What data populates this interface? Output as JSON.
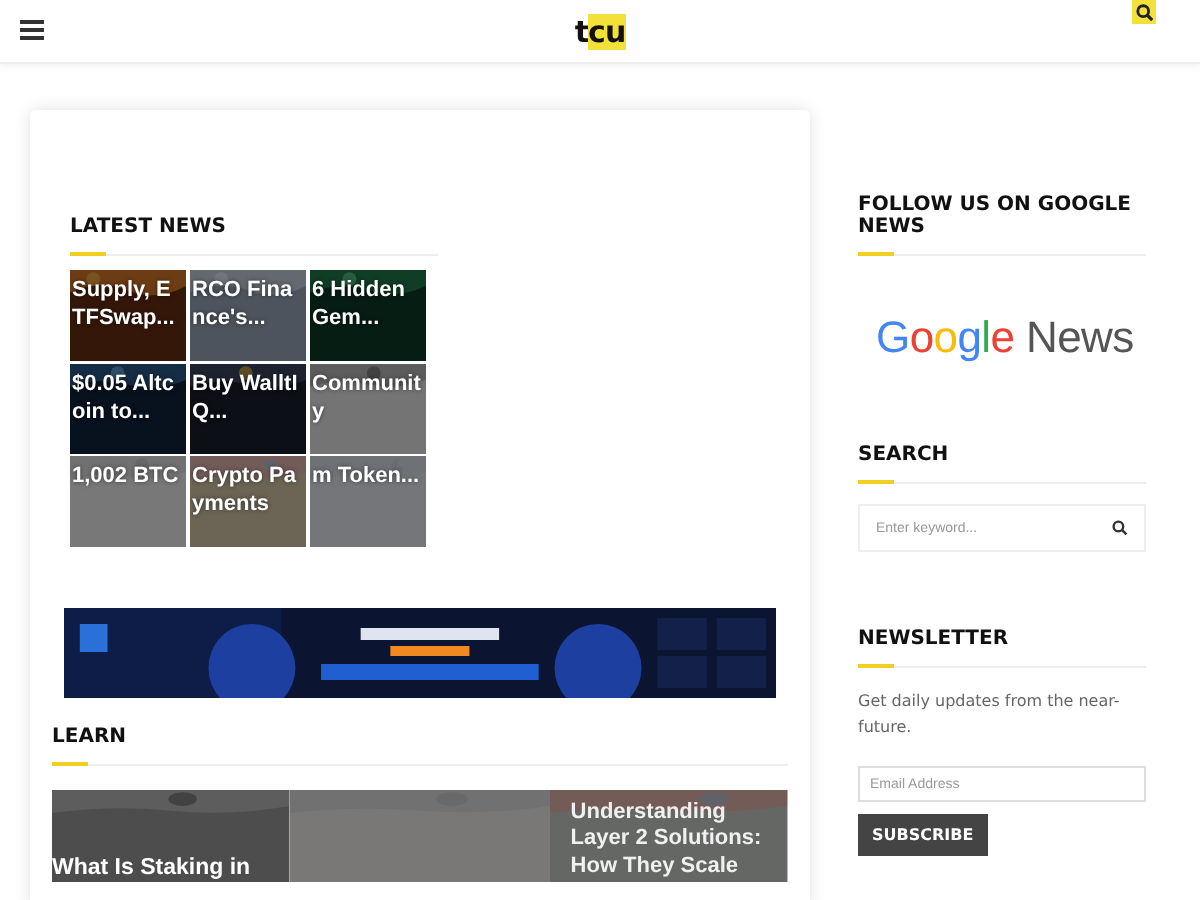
{
  "header": {
    "logo": "tcu"
  },
  "latest_news": {
    "title": "LATEST NEWS",
    "tiles": [
      {
        "title": "Supply, ETFSwap..."
      },
      {
        "title": "RCO Finance's..."
      },
      {
        "title": "6 Hidden Gem..."
      },
      {
        "title": "$0.05 Altcoin to..."
      },
      {
        "title": "Buy WalltIQ..."
      },
      {
        "title": "Community"
      },
      {
        "title": "1,002 BTC"
      },
      {
        "title": "Crypto Payments"
      },
      {
        "title": "m Token..."
      }
    ]
  },
  "learn": {
    "title": "LEARN",
    "cards": [
      {
        "kind": "article",
        "title": "What Is Staking in"
      },
      {
        "kind": "picture"
      },
      {
        "kind": "article",
        "title": "Understanding Layer 2 Solutions: How They Scale"
      }
    ]
  },
  "sidebar": {
    "google_news": {
      "title": "FOLLOW US ON GOOGLE NEWS",
      "logo": "Google News"
    },
    "search": {
      "title": "SEARCH",
      "placeholder": "Enter keyword..."
    },
    "newsletter": {
      "title": "NEWSLETTER",
      "text": "Get daily updates from the near-future.",
      "placeholder": "Email Address",
      "button": "SUBSCRIBE"
    }
  }
}
